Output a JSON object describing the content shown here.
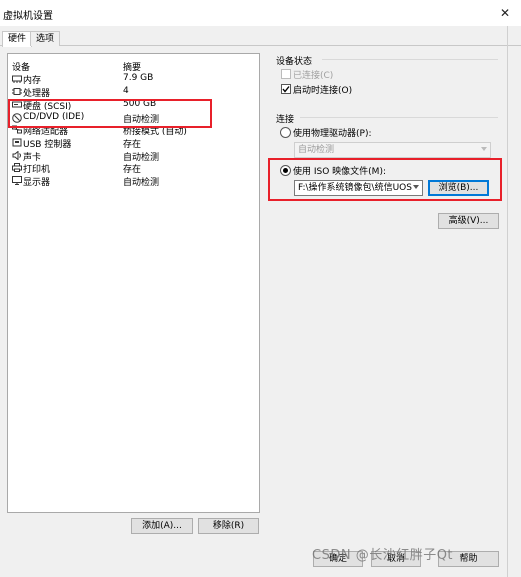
{
  "window": {
    "title": "虚拟机设置"
  },
  "tabs": [
    {
      "label": "硬件"
    },
    {
      "label": "选项"
    }
  ],
  "device_list": {
    "headers": {
      "device": "设备",
      "summary": "摘要"
    },
    "rows": [
      {
        "name": "内存",
        "summary": "7.9 GB",
        "icon": "memory-icon"
      },
      {
        "name": "处理器",
        "summary": "4",
        "icon": "cpu-icon"
      },
      {
        "name": "硬盘 (SCSI)",
        "summary": "500 GB",
        "icon": "hard-disk-icon"
      },
      {
        "name": "CD/DVD (IDE)",
        "summary": "自动检测",
        "icon": "cd-dvd-icon"
      },
      {
        "name": "网络适配器",
        "summary": "桥接模式 (自动)",
        "icon": "network-adapter-icon"
      },
      {
        "name": "USB 控制器",
        "summary": "存在",
        "icon": "usb-icon"
      },
      {
        "name": "声卡",
        "summary": "自动检测",
        "icon": "speaker-icon"
      },
      {
        "name": "打印机",
        "summary": "存在",
        "icon": "printer-icon"
      },
      {
        "name": "显示器",
        "summary": "自动检测",
        "icon": "monitor-icon"
      }
    ],
    "add_label": "添加(A)...",
    "remove_label": "移除(R)"
  },
  "device_status": {
    "title": "设备状态",
    "connected_label": "已连接(C)",
    "connect_on_start_label": "启动时连接(O)"
  },
  "connection": {
    "title": "连接",
    "physical_drive_label": "使用物理驱动器(P):",
    "physical_drive_value": "自动检测",
    "iso_label": "使用 ISO 映像文件(M):",
    "iso_path": "F:\\操作系统镜像包\\统信UOS",
    "browse_label": "浏览(B)...",
    "advanced_label": "高级(V)..."
  },
  "footer": {
    "ok_label": "确定",
    "cancel_label": "取消",
    "help_label": "帮助"
  },
  "watermark": "CSDN @长沙红胖子Qt"
}
